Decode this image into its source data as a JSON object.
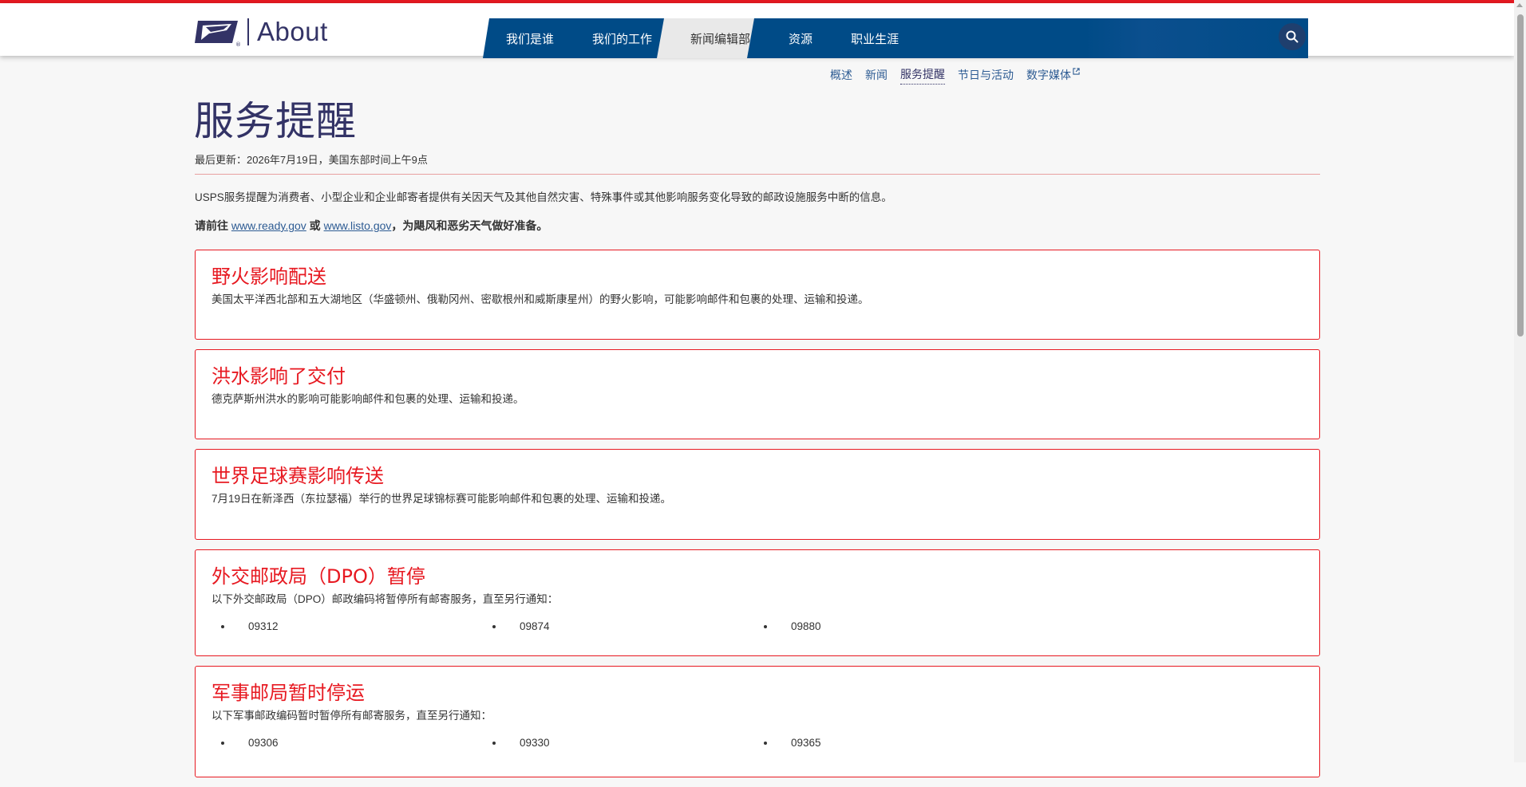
{
  "brand": {
    "logo_text": "About",
    "accent_red": "#e71921",
    "nav_blue": "#004b87",
    "navy": "#333366"
  },
  "nav": {
    "items": [
      {
        "label": "我们是谁"
      },
      {
        "label": "我们的工作"
      },
      {
        "label": "新闻编辑部"
      },
      {
        "label": "资源"
      },
      {
        "label": "职业生涯"
      }
    ],
    "active_index": 2,
    "search_icon": "search-icon"
  },
  "subnav": {
    "items": [
      {
        "label": "概述"
      },
      {
        "label": "新闻"
      },
      {
        "label": "服务提醒"
      },
      {
        "label": "节日与活动"
      },
      {
        "label": "数字媒体"
      }
    ],
    "current_index": 2,
    "external_icon": "external-link-icon"
  },
  "page": {
    "title": "服务提醒",
    "updated": "最后更新：2026年7月19日，美国东部时间上午9点",
    "intro": "USPS服务提醒为消费者、小型企业和企业邮寄者提供有关因天气及其他自然灾害、特殊事件或其他影响服务变化导致的邮政设施服务中断的信息。",
    "prep": {
      "prefix": "请前往 ",
      "link1": "www.ready.gov",
      "middle": " 或 ",
      "link2": "www.listo.gov",
      "suffix": "，为飓风和恶劣天气做好准备。"
    }
  },
  "alerts": [
    {
      "title": "野火影响配送",
      "body": "美国太平洋西北部和五大湖地区（华盛顿州、俄勒冈州、密歇根州和威斯康星州）的野火影响，可能影响邮件和包裹的处理、运输和投递。"
    },
    {
      "title": "洪水影响了交付",
      "body": "德克萨斯州洪水的影响可能影响邮件和包裹的处理、运输和投递。"
    },
    {
      "title": "世界足球赛影响传送",
      "body": "7月19日在新泽西（东拉瑟福）举行的世界足球锦标赛可能影响邮件和包裹的处理、运输和投递。"
    },
    {
      "title": "外交邮政局（DPO）暂停",
      "body": "以下外交邮政局（DPO）邮政编码将暂停所有邮寄服务，直至另行通知：",
      "zips": [
        "09312",
        "09874",
        "09880"
      ]
    },
    {
      "title": "军事邮局暂时停运",
      "body": "以下军事邮政编码暂时暂停所有邮寄服务，直至另行通知：",
      "zips": [
        "09306",
        "09330",
        "09365"
      ]
    }
  ]
}
